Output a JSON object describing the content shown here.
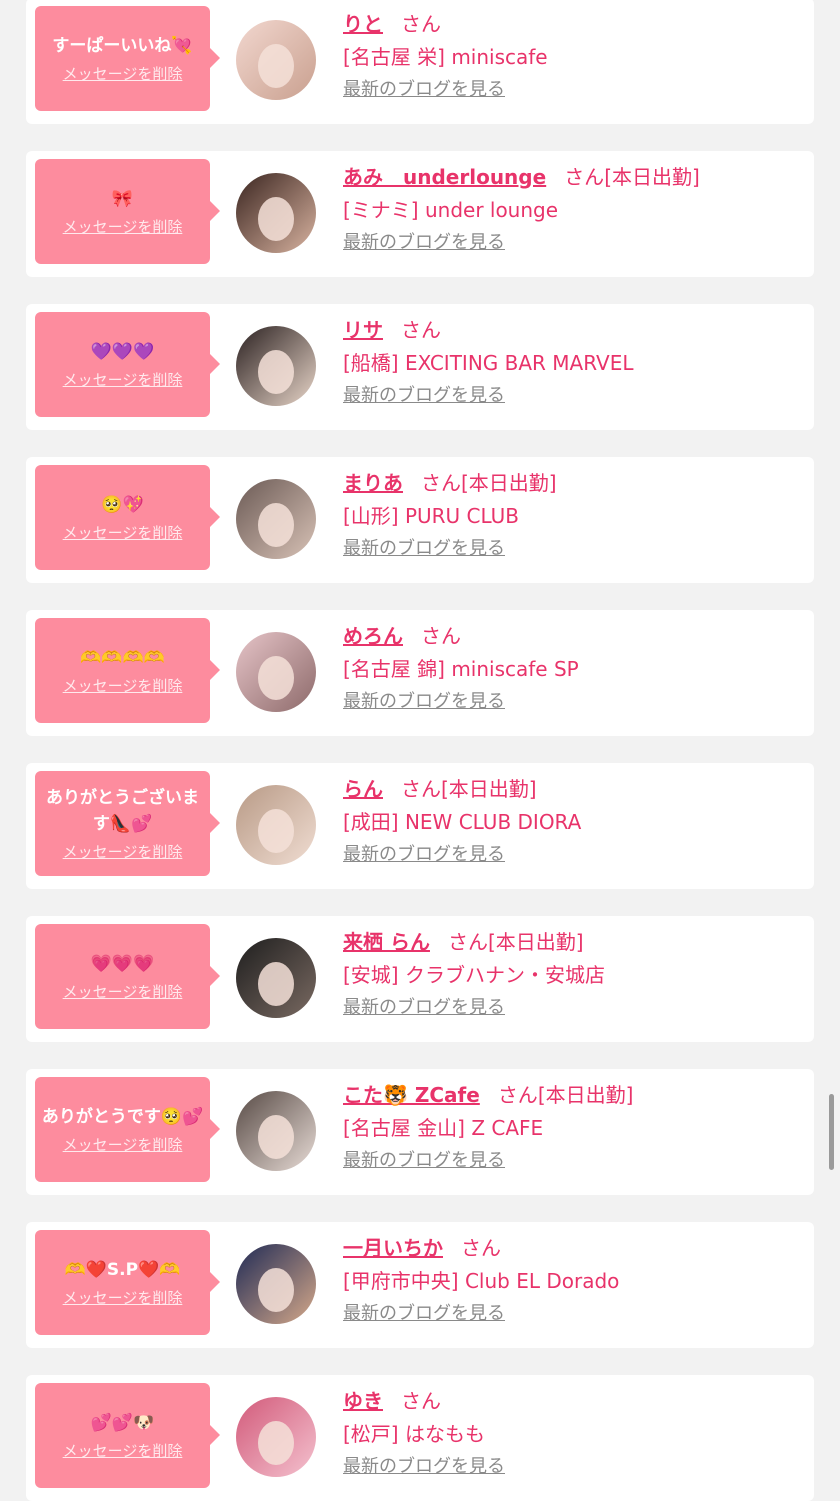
{
  "messages": [
    {
      "message": "すーぱーいいね💘",
      "delete_label": "メッセージを削除",
      "name": "りと",
      "honorific": "さん",
      "badge": "",
      "shop": "[名古屋 栄] miniscafe",
      "blog_link": "最新のブログを見る",
      "avatar_colors": [
        "#f2d7cf",
        "#c9a08f"
      ]
    },
    {
      "message": "🎀",
      "delete_label": "メッセージを削除",
      "name": "あみ　underlounge",
      "honorific": "さん",
      "badge": "[本日出勤]",
      "shop": "[ミナミ] under lounge",
      "blog_link": "最新のブログを見る",
      "avatar_colors": [
        "#3a2520",
        "#d9b3a0"
      ]
    },
    {
      "message": "💜💜💜",
      "delete_label": "メッセージを削除",
      "name": "リサ",
      "honorific": "さん",
      "badge": "",
      "shop": "[船橋] EXCITING BAR MARVEL",
      "blog_link": "最新のブログを見る",
      "avatar_colors": [
        "#2a2020",
        "#e9d6c9"
      ]
    },
    {
      "message": "🥺💖",
      "delete_label": "メッセージを削除",
      "name": "まりあ",
      "honorific": "さん",
      "badge": "[本日出勤]",
      "shop": "[山形] PURU CLUB",
      "blog_link": "最新のブログを見る",
      "avatar_colors": [
        "#6b5a55",
        "#d8c2b6"
      ]
    },
    {
      "message": "🫶🫶🫶🫶",
      "delete_label": "メッセージを削除",
      "name": "めろん",
      "honorific": "さん",
      "badge": "",
      "shop": "[名古屋 錦] miniscafe SP",
      "blog_link": "最新のブログを見る",
      "avatar_colors": [
        "#e6c4c8",
        "#8d6a6a"
      ]
    },
    {
      "message": "ありがとうございます👠💕",
      "delete_label": "メッセージを削除",
      "name": "らん",
      "honorific": "さん",
      "badge": "[本日出勤]",
      "shop": "[成田] NEW CLUB DIORA",
      "blog_link": "最新のブログを見る",
      "avatar_colors": [
        "#b89a86",
        "#f0ddd2"
      ]
    },
    {
      "message": "💗💗💗",
      "delete_label": "メッセージを削除",
      "name": "来栖 らん",
      "honorific": "さん",
      "badge": "[本日出勤]",
      "shop": "[安城] クラブハナン・安城店",
      "blog_link": "最新のブログを見る",
      "avatar_colors": [
        "#1e1e1e",
        "#7a6a62"
      ]
    },
    {
      "message": "ありがとうです🥺💕",
      "delete_label": "メッセージを削除",
      "name": "こた🐯 ZCafe",
      "honorific": "さん",
      "badge": "[本日出勤]",
      "shop": "[名古屋 金山] Z CAFE",
      "blog_link": "最新のブログを見る",
      "avatar_colors": [
        "#574a45",
        "#e8dcd6"
      ]
    },
    {
      "message": "🫶❤️S.P❤️🫶",
      "delete_label": "メッセージを削除",
      "name": "一月いちか",
      "honorific": "さん",
      "badge": "",
      "shop": "[甲府市中央] Club EL Dorado",
      "blog_link": "最新のブログを見る",
      "avatar_colors": [
        "#1f2a55",
        "#d6a98a"
      ]
    },
    {
      "message": "💕💕🐶",
      "delete_label": "メッセージを削除",
      "name": "ゆき",
      "honorific": "さん",
      "badge": "",
      "shop": "[松戸] はなもも",
      "blog_link": "最新のブログを見る",
      "avatar_colors": [
        "#d25a7a",
        "#f4c2cf"
      ]
    }
  ],
  "colors": {
    "bubble": "#fd8c9e",
    "name": "#e8336a",
    "link_gray": "#8a8a8a",
    "background": "#f2f2f2"
  }
}
